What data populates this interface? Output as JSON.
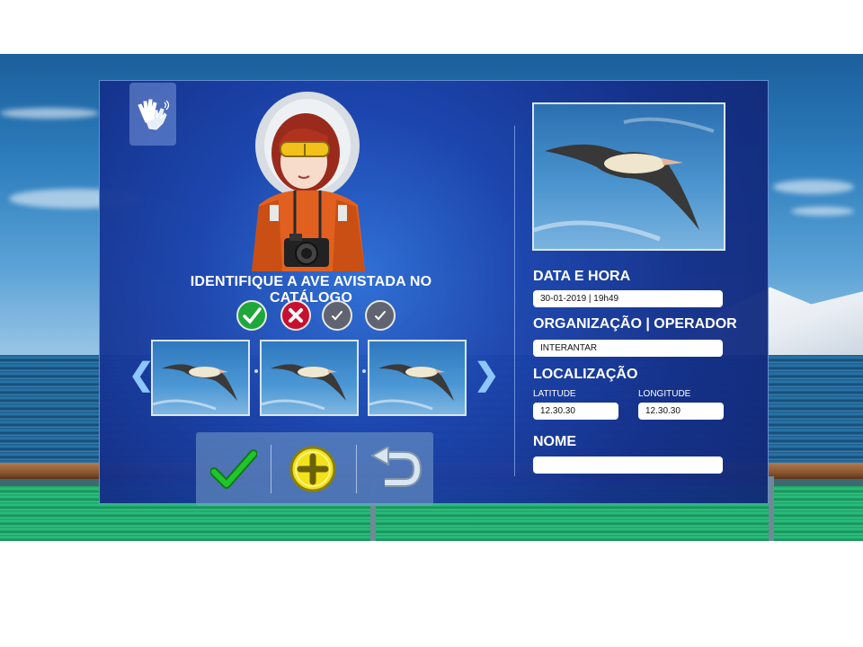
{
  "instruction": "IDENTIFIQUE A AVE AVISTADA NO CATÁLOGO",
  "status_icons": [
    {
      "name": "correct-icon",
      "color": "#1ea83a"
    },
    {
      "name": "wrong-icon",
      "color": "#c8102e"
    },
    {
      "name": "pending-icon",
      "color": "#5f6470"
    },
    {
      "name": "pending-icon",
      "color": "#5f6470"
    }
  ],
  "carousel": {
    "prev_icon": "chevron-left-icon",
    "next_icon": "chevron-right-icon",
    "prev_glyph": "❮",
    "next_glyph": "❯",
    "thumbnails": [
      {
        "icon": "albatross-photo"
      },
      {
        "icon": "albatross-photo"
      },
      {
        "icon": "albatross-photo"
      }
    ]
  },
  "actions": [
    {
      "name": "confirm-button",
      "icon": "check-icon",
      "color": "#22c42b"
    },
    {
      "name": "add-button",
      "icon": "plus-icon",
      "color": "#f3e21a"
    },
    {
      "name": "back-button",
      "icon": "undo-icon",
      "color": "#d9e6f2"
    }
  ],
  "accessibility": {
    "icon": "sign-language-icon"
  },
  "form": {
    "date_label": "DATA E HORA",
    "date_value": "30-01-2019 | 19h49",
    "org_label": "ORGANIZAÇÃO | OPERADOR",
    "org_value": "INTERANTAR",
    "location_label": "LOCALIZAÇÃO",
    "latitude_label": "LATITUDE",
    "latitude_value": "12.30.30",
    "longitude_label": "LONGITUDE",
    "longitude_value": "12.30.30",
    "name_label": "NOME",
    "name_value": ""
  },
  "colors": {
    "panel": "#1c44ad",
    "accent": "#8ec7ff",
    "text": "#ffffff"
  }
}
